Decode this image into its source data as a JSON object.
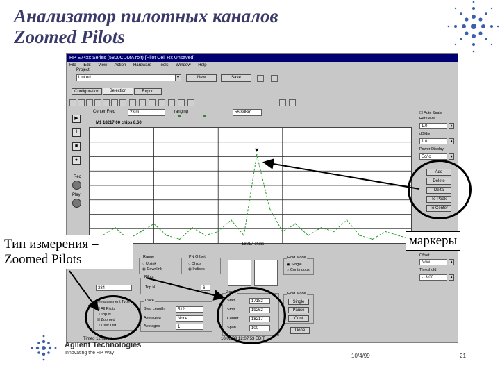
{
  "slide": {
    "title_line1": "Анализатор пилотных каналов",
    "title_line2": "Zoomed Pilots",
    "callout_measure_line1": "Тип измерения =",
    "callout_measure_line2": "Zoomed Pilots",
    "callout_markers": "маркеры",
    "footer_brand": "Agilent Technologies",
    "footer_tagline": "Innovating the HP Way",
    "footer_date": "10/4/99",
    "footer_page": "21"
  },
  "app": {
    "titlebar": "HP E74xx Series (5800CDMA rolt) [Pilot  Cell Rx  Unsaved]",
    "menu": [
      "File",
      "Edit",
      "View",
      "Action",
      "Hardware",
      "Tools",
      "Window",
      "Help"
    ],
    "project_label": "Project",
    "project_value": "Unt ed",
    "buttons": {
      "new": "New",
      "save": "Save"
    },
    "tabs": [
      "Configuration",
      "Selection",
      "Export"
    ],
    "center_freq_label": "Center Freq",
    "center_freq_value": "23 m",
    "ranging_label": "ranging",
    "ref_value": "56.8dBm",
    "marker_readout": "M1 18217.00 chips  8.60",
    "x_axis_label": "18217 chips",
    "right_panel": {
      "autoscale_label": "Auto Scale",
      "ref_level_label": "Ref Level",
      "ref_level_value": "1.0",
      "db_div_label": "dB/div",
      "db_div_value": "1.0",
      "power_display_label": "Power Display",
      "power_display_value": "Ec/Io",
      "marker_buttons": [
        "Add",
        "Delete",
        "Delta",
        "To Peak",
        "To Center"
      ],
      "offset_label": "Offset",
      "offset_value": "Now",
      "threshold_label": "Threshold",
      "threshold_value": "-13.00"
    },
    "left_panel": {
      "rec_label": "Rec",
      "play_label": "Play",
      "pilots_value": "384"
    },
    "groups": {
      "measurement_type_title": "Measurement Type",
      "measurement_types": [
        "All Pilots",
        "Top N",
        "Zoomed",
        "User List"
      ],
      "range_title": "Range",
      "range_options": [
        "Uplink",
        "Downlink"
      ],
      "pn_offset_title": "PN Offset",
      "pn_options": [
        "Chips",
        "Indices"
      ],
      "pilots_title": "Pilots",
      "top_n_label": "Top N",
      "top_n_value": "6",
      "trace_title": "Trace",
      "trace_rows": [
        {
          "label": "Step Length",
          "value": "512"
        },
        {
          "label": "Averaging",
          "value": "None"
        },
        {
          "label": "Averages",
          "value": "1"
        }
      ],
      "zoom_title": "Zoom",
      "zoom_rows": [
        {
          "label": "Start",
          "value": "17182"
        },
        {
          "label": "Stop",
          "value": "19262"
        },
        {
          "label": "Center",
          "value": "18217"
        },
        {
          "label": "Span",
          "value": "100"
        }
      ],
      "trigger_title": "Hold Mode",
      "trigger_options": [
        "Single",
        "Continuous"
      ],
      "hold_title": "Hold Mode",
      "hold_buttons": [
        "Single",
        "Pause",
        "Cont"
      ],
      "done_label": "Done"
    },
    "status_left": "Timed 12 labels",
    "status_right": "10/08/99 12:07:53  EDIT"
  },
  "chart_data": {
    "type": "line",
    "title": "",
    "xlabel": "18217 chips",
    "ylabel": "",
    "x": [
      0,
      4,
      8,
      12,
      16,
      20,
      24,
      28,
      32,
      36,
      40,
      44,
      48,
      52,
      56,
      60,
      64,
      68,
      72,
      76,
      80,
      84,
      88,
      92,
      96,
      100
    ],
    "series": [
      {
        "values": [
          1,
          2,
          4,
          1,
          3,
          5,
          2,
          1,
          4,
          2,
          3,
          6,
          2,
          23,
          9,
          3,
          5,
          2,
          4,
          3,
          6,
          2,
          1,
          3,
          2,
          1
        ]
      }
    ],
    "ylim": [
      0,
      30
    ],
    "grid": true,
    "marker_x": 52
  }
}
